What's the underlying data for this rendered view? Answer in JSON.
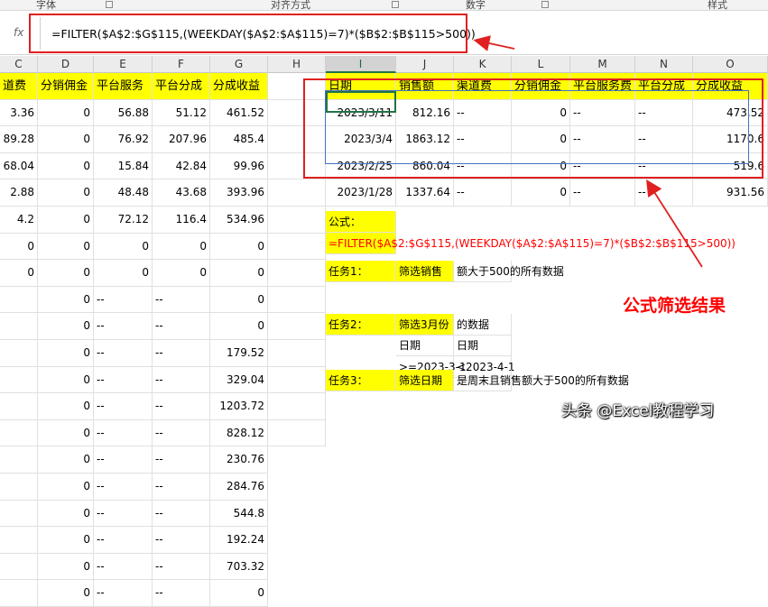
{
  "ribbon": {
    "groups": [
      "字体",
      "对齐方式",
      "数字",
      "样式"
    ]
  },
  "formula_bar": {
    "fx_label": "fx",
    "formula": "=FILTER($A$2:$G$115,(WEEKDAY($A$2:$A$115)=7)*($B$2:$B$115>500))"
  },
  "columns": [
    "C",
    "D",
    "E",
    "F",
    "G",
    "H",
    "I",
    "J",
    "K",
    "L",
    "M",
    "N",
    "O"
  ],
  "left_table": {
    "headers": [
      "道费",
      "分销佣金",
      "平台服务",
      "平台分成",
      "分成收益"
    ],
    "rows": [
      [
        "3.36",
        "0",
        "56.88",
        "51.12",
        "461.52"
      ],
      [
        "89.28",
        "0",
        "76.92",
        "207.96",
        "485.4"
      ],
      [
        "68.04",
        "0",
        "15.84",
        "42.84",
        "99.96"
      ],
      [
        "2.88",
        "0",
        "48.48",
        "43.68",
        "393.96"
      ],
      [
        "4.2",
        "0",
        "72.12",
        "116.4",
        "534.96"
      ],
      [
        "0",
        "0",
        "0",
        "0",
        "0"
      ],
      [
        "0",
        "0",
        "0",
        "0",
        "0"
      ],
      [
        "",
        "0",
        "--",
        "--",
        "0"
      ],
      [
        "",
        "0",
        "--",
        "--",
        "0"
      ],
      [
        "",
        "0",
        "--",
        "--",
        "179.52"
      ],
      [
        "",
        "0",
        "--",
        "--",
        "329.04"
      ],
      [
        "",
        "0",
        "--",
        "--",
        "1203.72"
      ],
      [
        "",
        "0",
        "--",
        "--",
        "828.12"
      ],
      [
        "",
        "0",
        "--",
        "--",
        "230.76"
      ],
      [
        "",
        "0",
        "--",
        "--",
        "284.76"
      ],
      [
        "",
        "0",
        "--",
        "--",
        "544.8"
      ],
      [
        "",
        "0",
        "--",
        "--",
        "192.24"
      ],
      [
        "",
        "0",
        "--",
        "--",
        "703.32"
      ],
      [
        "",
        "0",
        "--",
        "--",
        "0"
      ]
    ]
  },
  "result_table": {
    "headers": [
      "日期",
      "销售额",
      "渠道费",
      "分销佣金",
      "平台服务费",
      "平台分成",
      "分成收益"
    ],
    "rows": [
      [
        "2023/3/11",
        "812.16",
        "--",
        "0",
        "--",
        "--",
        "473.52"
      ],
      [
        "2023/3/4",
        "1863.12",
        "--",
        "0",
        "--",
        "--",
        "1170.6"
      ],
      [
        "2023/2/25",
        "860.04",
        "--",
        "0",
        "--",
        "--",
        "519.6"
      ],
      [
        "2023/1/28",
        "1337.64",
        "--",
        "0",
        "--",
        "--",
        "931.56"
      ]
    ]
  },
  "notes": {
    "formula_label": "公式：",
    "formula_text": "=FILTER($A$2:$G$115,(WEEKDAY($A$2:$A$115)=7)*($B$2:$B$115>500))",
    "task1_label": "任务1：",
    "task1_a": "筛选销售",
    "task1_b": "额大于500的所有数据",
    "task2_label": "任务2：",
    "task2_a": "筛选3月份",
    "task2_b": "的数据",
    "date_label_1": "日期",
    "date_label_2": "日期",
    "crit_1": ">=2023-3-1",
    "crit_2": "<2023-4-1",
    "task3_label": "任务3：",
    "task3_a": "筛选日期",
    "task3_b": "是周末且销售额大于500的所有数据"
  },
  "annotation": "公式筛选结果",
  "watermark": "头条 @Excel教程学习",
  "colors": {
    "highlight": "#ffff00",
    "annotation_red": "#e02020",
    "excel_green": "#217346",
    "selection_blue": "#4472c4"
  }
}
